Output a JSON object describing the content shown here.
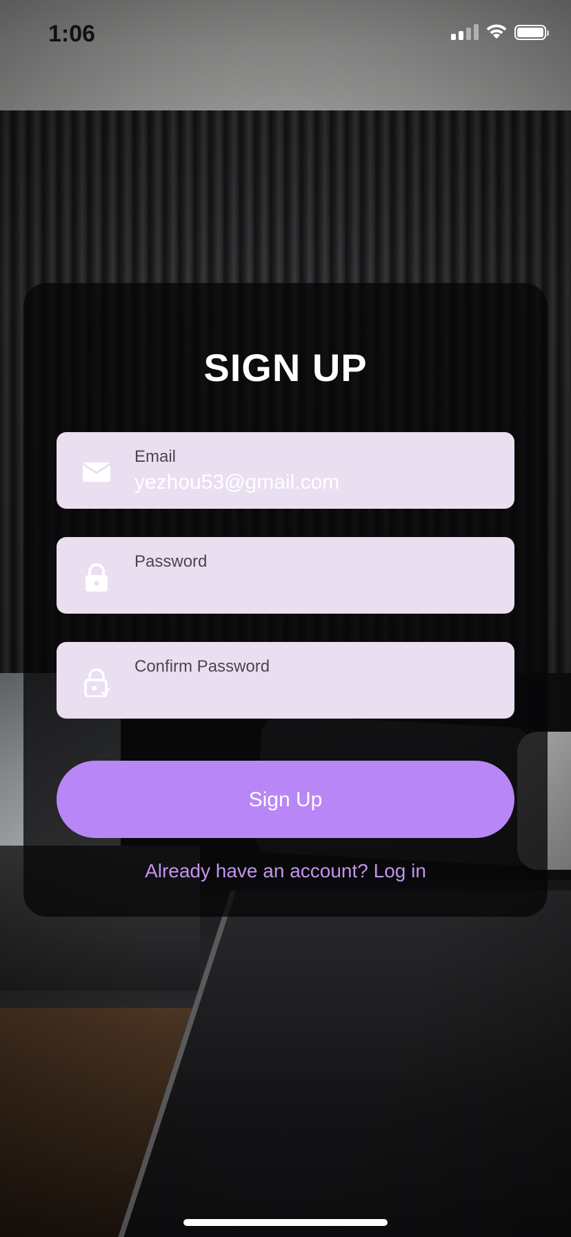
{
  "status_bar": {
    "time": "1:06",
    "icons": [
      "signal-icon",
      "wifi-icon",
      "battery-icon"
    ]
  },
  "title": "SIGN UP",
  "fields": [
    {
      "label": "Email",
      "value": "yezhou53@gmail.com",
      "icon": "mail-icon"
    },
    {
      "label": "Password",
      "value": "",
      "icon": "lock-icon"
    },
    {
      "label": "Confirm Password",
      "value": "",
      "icon": "lock-check-icon"
    }
  ],
  "signup_button": "Sign Up",
  "login_link": "Already have an account? Log in",
  "colors": {
    "accent": "#b987f5",
    "link": "#c394f0",
    "field_bg": "#e9dff0",
    "card_bg": "#060608"
  }
}
